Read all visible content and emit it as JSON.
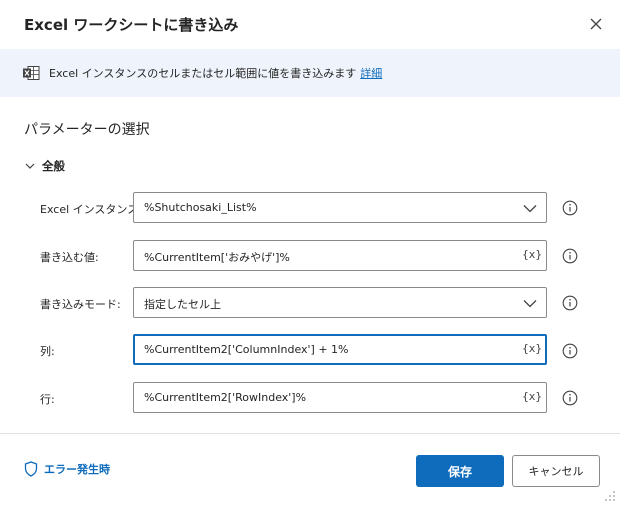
{
  "dialog": {
    "title": "Excel ワークシートに書き込み",
    "close_icon": "close-icon"
  },
  "info": {
    "icon": "excel-icon",
    "text": "Excel インスタンスのセルまたはセル範囲に値を書き込みます",
    "link": "詳細"
  },
  "section": {
    "title": "パラメーターの選択"
  },
  "group": {
    "label": "全般",
    "icon": "chevron-down-icon"
  },
  "fields": [
    {
      "label": "Excel インスタンス:",
      "value": "%Shutchosaki_List%",
      "kind": "dropdown"
    },
    {
      "label": "書き込む値:",
      "value": "%CurrentItem['おみやげ']%",
      "kind": "text",
      "var_button": "{x}"
    },
    {
      "label": "書き込みモード:",
      "value": "指定したセル上",
      "kind": "dropdown"
    },
    {
      "label": "列:",
      "value": "%CurrentItem2['ColumnIndex'] + 1%",
      "kind": "text",
      "var_button": "{x}",
      "focused": true
    },
    {
      "label": "行:",
      "value": "%CurrentItem2['RowIndex']%",
      "kind": "text",
      "var_button": "{x}"
    }
  ],
  "footer": {
    "error_label": "エラー発生時",
    "error_icon": "shield-icon",
    "save_label": "保存",
    "cancel_label": "キャンセル"
  },
  "colors": {
    "accent": "#0f6cbd",
    "info_bg": "#eff4fc",
    "excel_green": "#107c41"
  }
}
